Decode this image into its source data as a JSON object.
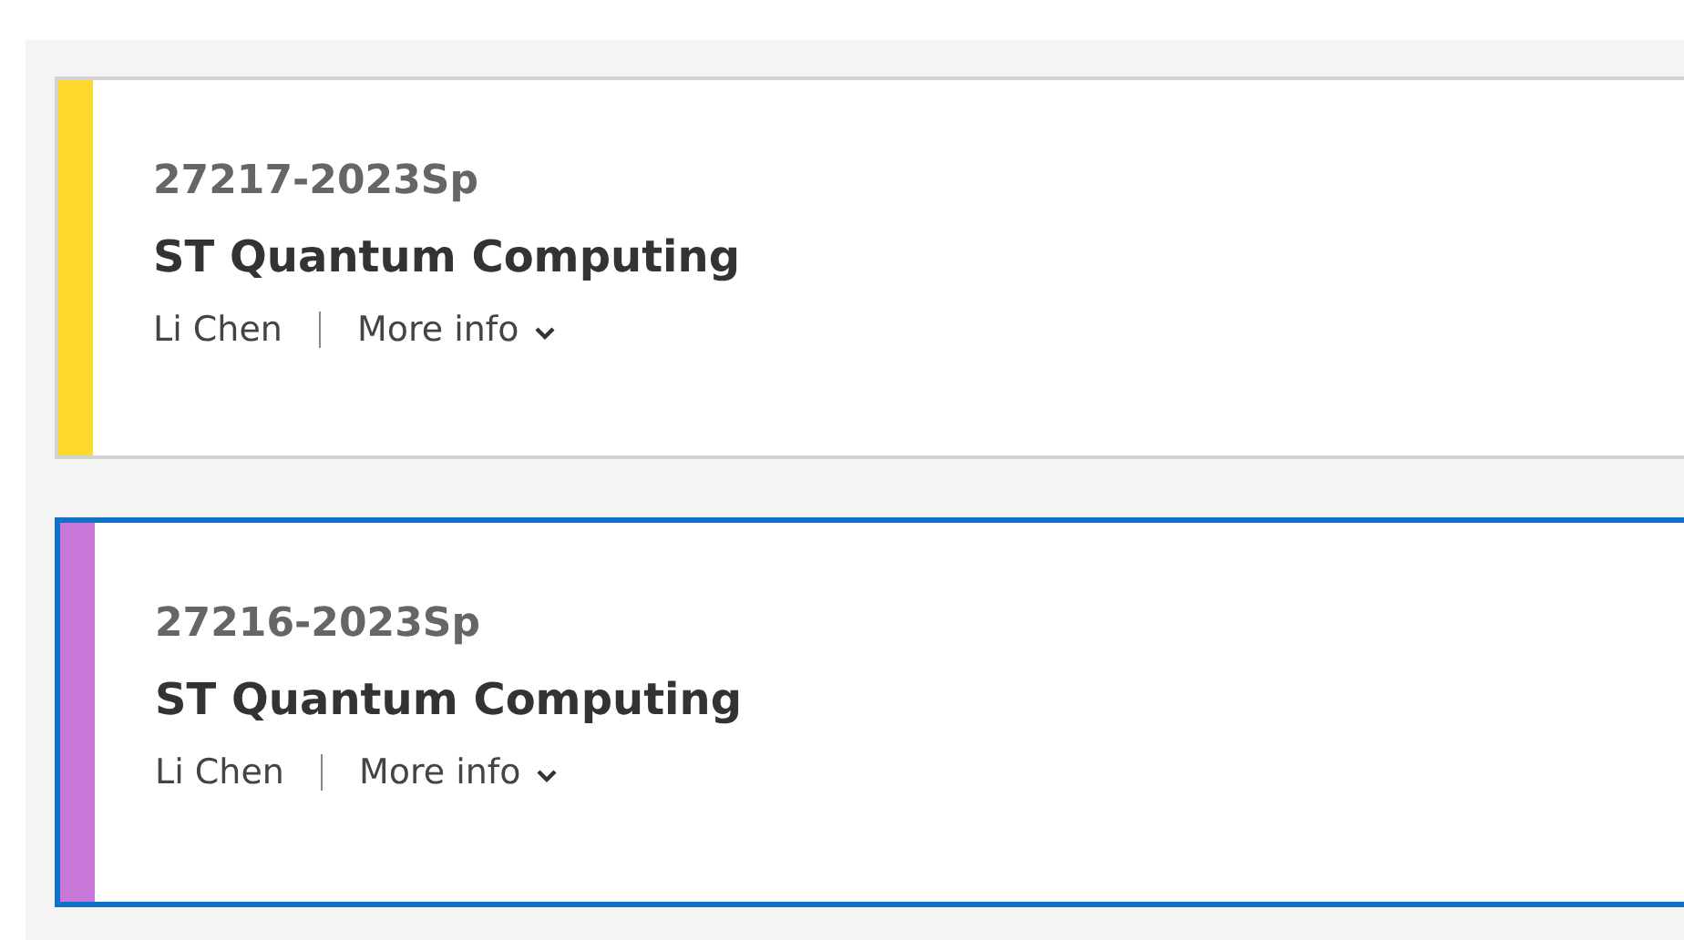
{
  "courses": [
    {
      "code": "27217-2023Sp",
      "title": "ST Quantum Computing",
      "instructor": "Li Chen",
      "more_label": "More info",
      "color": "#fdd92e",
      "selected": false
    },
    {
      "code": "27216-2023Sp",
      "title": "ST Quantum Computing",
      "instructor": "Li Chen",
      "more_label": "More info",
      "color": "#c877d8",
      "selected": true
    }
  ]
}
